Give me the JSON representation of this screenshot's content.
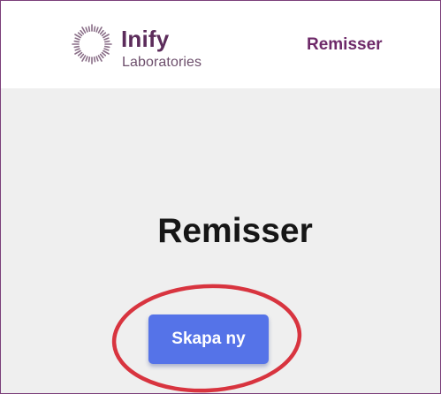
{
  "header": {
    "logo": {
      "name": "Inify",
      "subtitle": "Laboratories"
    },
    "nav": {
      "remisser_link": "Remisser"
    }
  },
  "main": {
    "title": "Remisser",
    "create_button": "Skapa ny"
  },
  "colors": {
    "brand_purple": "#6e2a69",
    "button_blue": "#5573e8",
    "annotation_red": "#d8343f",
    "background": "#efefef"
  },
  "icons": {
    "logo_mark": "sunburst-logo-icon"
  }
}
